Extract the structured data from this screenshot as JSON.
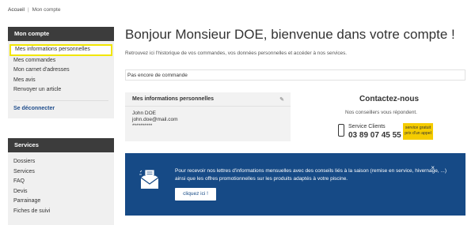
{
  "breadcrumb": {
    "home": "Accueil",
    "current": "Mon compte"
  },
  "sidebar": {
    "account_header": "Mon compte",
    "items": [
      {
        "label": "Mes informations personnelles"
      },
      {
        "label": "Mes commandes"
      },
      {
        "label": "Mon carnet d'adresses"
      },
      {
        "label": "Mes avis"
      },
      {
        "label": "Renvoyer un article"
      }
    ],
    "logout": "Se déconnecter",
    "services_header": "Services",
    "services": [
      {
        "label": "Dossiers"
      },
      {
        "label": "Services"
      },
      {
        "label": "FAQ"
      },
      {
        "label": "Devis"
      },
      {
        "label": "Parrainage"
      },
      {
        "label": "Fiches de suivi"
      }
    ]
  },
  "main": {
    "title": "Bonjour Monsieur DOE, bienvenue dans votre compte !",
    "subtitle": "Retrouvez ici l'historique de vos commandes, vos données personnelles et accéder à nos services.",
    "no_order": "Pas encore de commande"
  },
  "info_card": {
    "title": "Mes informations personnelles",
    "name": "John DOE",
    "email": "john.doe@mail.com",
    "password": "**********"
  },
  "contact": {
    "title": "Contactez-nous",
    "subtitle": "Nos conseillers vous répondent.",
    "service_label": "Service Clients",
    "phone": "03 89 07 45 55",
    "badge_line1": "service gratuit",
    "badge_line2": "prix d'un appel",
    "badge_color": "#f5cc00"
  },
  "newsletter": {
    "text": "Pour recevoir nos lettres d'informations mensuelles avec des conseils liés à la saison (remise en service, hivernage, ...) ainsi que les offres promotionnelles sur les produits adaptés à votre piscine.",
    "button": "cliquez ici !",
    "close": "×",
    "background": "#164a86"
  }
}
